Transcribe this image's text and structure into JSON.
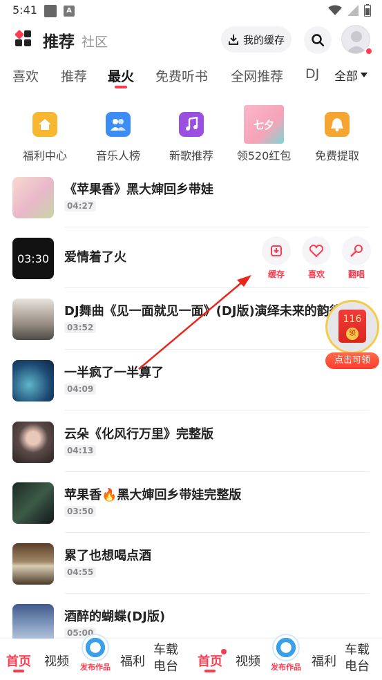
{
  "status": {
    "time": "5:41"
  },
  "header": {
    "title": "推荐",
    "subtitle": "社区",
    "cache_label": "我的缓存"
  },
  "tabs": [
    "喜欢",
    "推荐",
    "最火",
    "免费听书",
    "全网推荐",
    "DJ"
  ],
  "tabs_all": "全部",
  "shortcuts": [
    {
      "label": "福利中心",
      "icon": "home-icon",
      "color": "#f7b731"
    },
    {
      "label": "音乐人榜",
      "icon": "people-icon",
      "color": "#3b8df5"
    },
    {
      "label": "新歌推荐",
      "icon": "music-note-icon",
      "color": "#9b4fe0"
    },
    {
      "label": "领520红包",
      "icon": "qixi-banner",
      "banner_text": "七夕"
    },
    {
      "label": "免费提取",
      "icon": "bell-icon",
      "color": "#f7a531"
    }
  ],
  "songs": [
    {
      "title": "《苹果香》黑大婶回乡带娃",
      "duration": "04:27"
    },
    {
      "title": "爱情着了火",
      "duration": "",
      "thumb_text": "03:30"
    },
    {
      "title": "DJ舞曲《见一面就见一面》(DJ版)演绎未来的韵律",
      "duration": "03:52"
    },
    {
      "title": "一半疯了一半算了",
      "duration": "04:09"
    },
    {
      "title": "云朵《化风行万里》完整版",
      "duration": "04:13"
    },
    {
      "title": "苹果香🔥黑大婶回乡带娃完整版",
      "duration": "03:50"
    },
    {
      "title": "累了也想喝点酒",
      "duration": "04:55"
    },
    {
      "title": "酒醉的蝴蝶(DJ版)",
      "duration": "05:00"
    }
  ],
  "actions": {
    "cache": "缓存",
    "like": "喜欢",
    "cover": "翻唱"
  },
  "red_packet": {
    "count": "116",
    "coin": "领",
    "pill": "点击可领"
  },
  "bottom_nav": {
    "home": "首页",
    "video": "视频",
    "publish": "发布作品",
    "welfare": "福利",
    "car": "车载",
    "radio": "电台"
  },
  "colors": {
    "accent": "#ff3b4e"
  }
}
